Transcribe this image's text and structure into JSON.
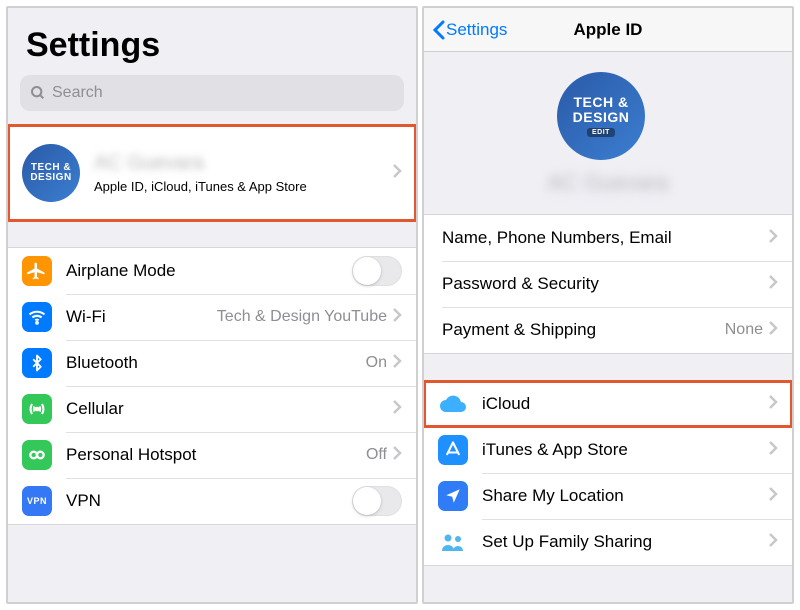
{
  "left": {
    "title": "Settings",
    "search_placeholder": "Search",
    "profile": {
      "avatar_line1": "TECH &",
      "avatar_line2": "DESIGN",
      "name": "AC Guevara",
      "subtitle": "Apple ID, iCloud, iTunes & App Store"
    },
    "rows": {
      "airplane": "Airplane Mode",
      "wifi": "Wi-Fi",
      "wifi_value": "Tech & Design YouTube",
      "bluetooth": "Bluetooth",
      "bluetooth_value": "On",
      "cellular": "Cellular",
      "hotspot": "Personal Hotspot",
      "hotspot_value": "Off",
      "vpn": "VPN",
      "vpn_badge": "VPN"
    }
  },
  "right": {
    "back": "Settings",
    "title": "Apple ID",
    "avatar_line1": "TECH &",
    "avatar_line2": "DESIGN",
    "avatar_edit": "EDIT",
    "name": "AC Guevara",
    "section1": {
      "name_numbers": "Name, Phone Numbers, Email",
      "password": "Password & Security",
      "payment": "Payment & Shipping",
      "payment_value": "None"
    },
    "section2": {
      "icloud": "iCloud",
      "itunes": "iTunes & App Store",
      "share": "Share My Location",
      "family": "Set Up Family Sharing"
    }
  },
  "colors": {
    "orange": "#ff9500",
    "blue": "#007aff",
    "green": "#34c759",
    "vpn": "#3478f6",
    "cloud": "#3cb0ff",
    "appstore": "#1e90ff",
    "location": "#2f7cf6",
    "family": "#4fb6f0",
    "highlight": "#e2572d"
  }
}
